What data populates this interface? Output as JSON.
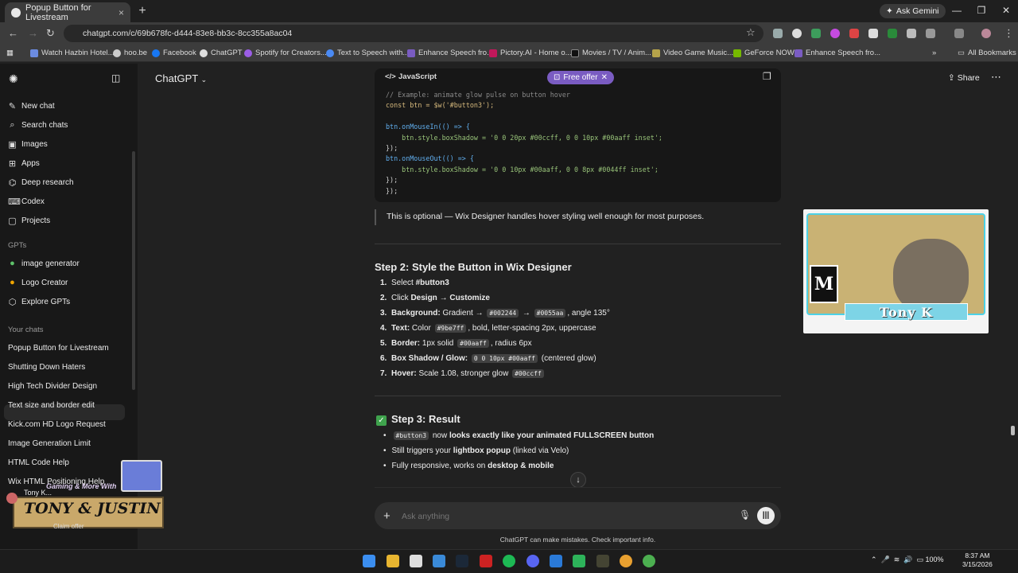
{
  "browser": {
    "tab_title": "Popup Button for Livestream",
    "tab_close": "×",
    "new_tab": "+",
    "ask_gemini": "Ask Gemini",
    "url": "chatgpt.com/c/69b678fc-d444-83e8-bb3c-8cc355a8ac04",
    "all_bookmarks": "All Bookmarks",
    "bookmarks": [
      "Watch Hazbin Hotel...",
      "hoo.be",
      "Facebook",
      "ChatGPT",
      "Spotify for Creators...",
      "Text to Speech with...",
      "Enhance Speech fro...",
      "Pictory.AI - Home o...",
      "Movies / TV / Anim...",
      "Video Game Music...",
      "GeForce NOW",
      "Enhance Speech fro..."
    ]
  },
  "sidebar": {
    "nav": [
      "New chat",
      "Search chats",
      "Images",
      "Apps",
      "Deep research",
      "Codex",
      "Projects"
    ],
    "gpts_heading": "GPTs",
    "gpts": [
      "image generator",
      "Logo Creator",
      "Explore GPTs"
    ],
    "chats_heading": "Your chats",
    "chats": [
      "Popup Button for Livestream",
      "Shutting Down Haters",
      "High Tech Divider Design",
      "Text size and border edit",
      "Kick.com HD Logo Request",
      "Image Generation Limit",
      "HTML Code Help",
      "Wix HTML Positioning Help"
    ]
  },
  "header": {
    "model": "ChatGPT",
    "free_offer": "Free offer",
    "share": "Share"
  },
  "codeblock": {
    "language": "JavaScript",
    "lines": [
      "// Example: animate glow pulse on button hover",
      "const btn = $w('#button3');",
      "",
      "btn.onMouseIn(() => {",
      "    btn.style.boxShadow = '0 0 20px #00ccff, 0 0 10px #00aaff inset';",
      "});",
      "btn.onMouseOut(() => {",
      "    btn.style.boxShadow = '0 0 10px #00aaff, 0 0 8px #0044ff inset';",
      "});",
      "});"
    ]
  },
  "content": {
    "optional_note": "This is optional — Wix Designer handles hover styling well enough for most purposes.",
    "step2_title": "Step 2: Style the Button in Wix Designer",
    "step2_items": [
      {
        "n": "1.",
        "pre": "Select ",
        "bold": "#button3",
        "rest": ""
      },
      {
        "n": "2.",
        "pre": "Click ",
        "bold": "Design → Customize",
        "rest": ""
      },
      {
        "n": "3.",
        "label": "Background:",
        "t1": " Gradient → ",
        "c1": "#002244",
        "t2": " → ",
        "c2": "#0055aa",
        "t3": ", angle 135°"
      },
      {
        "n": "4.",
        "label": "Text:",
        "t1": " Color ",
        "c1": "#9be7ff",
        "t2": ", bold, letter-spacing 2px, uppercase"
      },
      {
        "n": "5.",
        "label": "Border:",
        "t1": " 1px solid ",
        "c1": "#00aaff",
        "t2": ", radius 6px"
      },
      {
        "n": "6.",
        "label": "Box Shadow / Glow:",
        "c1": "0 0 10px #00aaff",
        "t2": " (centered glow)"
      },
      {
        "n": "7.",
        "label": "Hover:",
        "t1": " Scale 1.08, stronger glow ",
        "c1": "#00ccff"
      }
    ],
    "step3_check": "✓",
    "step3_title": "Step 3: Result",
    "step3_items": [
      {
        "code": "#button3",
        "t1": " now ",
        "b1": "looks exactly like your animated FULLSCREEN button"
      },
      {
        "t1": "Still triggers your ",
        "b1": "lightbox popup",
        "t2": " (linked via Velo)"
      },
      {
        "t1": "Fully responsive, works on ",
        "b1": "desktop & mobile"
      }
    ]
  },
  "composer": {
    "placeholder": "Ask anything",
    "disclaimer": "ChatGPT can make mistakes. Check important info."
  },
  "overlay": {
    "nameplate": "Tony K",
    "esrb": "M",
    "bottom_title": "TONY & JUSTIN",
    "bottom_sub": "Gaming & More With",
    "bottom_user": "Tony K...",
    "claim": "Claim offer"
  },
  "taskbar": {
    "tray": "100%",
    "time": "8:37 AM",
    "date": "3/15/2026"
  }
}
